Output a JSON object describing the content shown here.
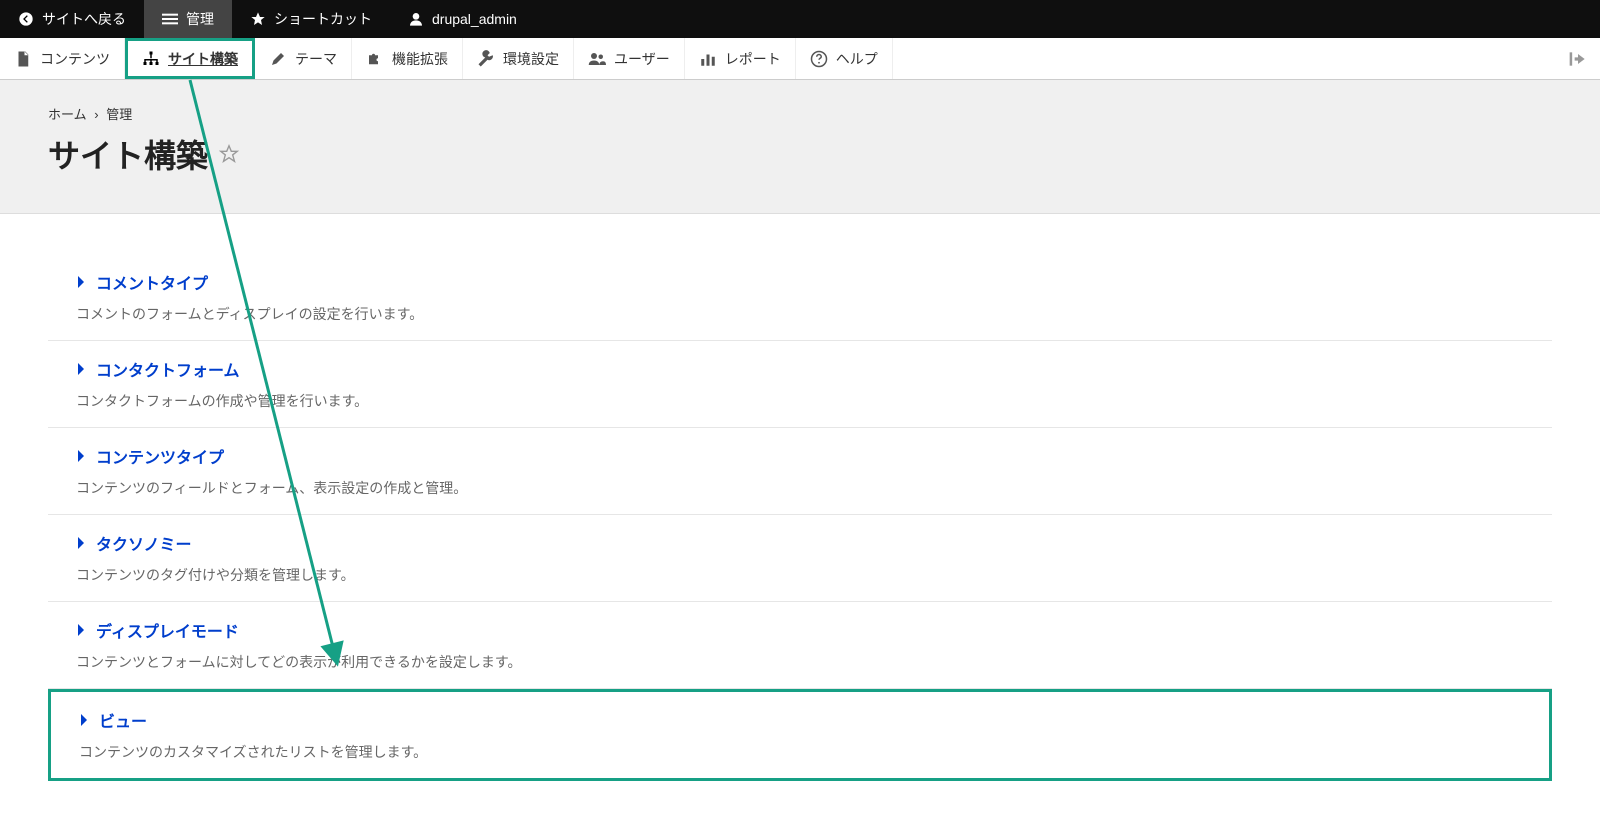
{
  "toolbar": {
    "back": "サイトへ戻る",
    "manage": "管理",
    "shortcuts": "ショートカット",
    "user": "drupal_admin"
  },
  "adminMenu": {
    "content": "コンテンツ",
    "structure": "サイト構築",
    "appearance": "テーマ",
    "extend": "機能拡張",
    "config": "環境設定",
    "people": "ユーザー",
    "reports": "レポート",
    "help": "ヘルプ"
  },
  "breadcrumb": {
    "home": "ホーム",
    "separator": "›",
    "admin": "管理"
  },
  "pageTitle": "サイト構築",
  "items": [
    {
      "title": "コメントタイプ",
      "desc": "コメントのフォームとディスプレイの設定を行います。"
    },
    {
      "title": "コンタクトフォーム",
      "desc": "コンタクトフォームの作成や管理を行います。"
    },
    {
      "title": "コンテンツタイプ",
      "desc": "コンテンツのフィールドとフォーム、表示設定の作成と管理。"
    },
    {
      "title": "タクソノミー",
      "desc": "コンテンツのタグ付けや分類を管理します。"
    },
    {
      "title": "ディスプレイモード",
      "desc": "コンテンツとフォームに対してどの表示が利用できるかを設定します。"
    },
    {
      "title": "ビュー",
      "desc": "コンテンツのカスタマイズされたリストを管理します。"
    }
  ]
}
